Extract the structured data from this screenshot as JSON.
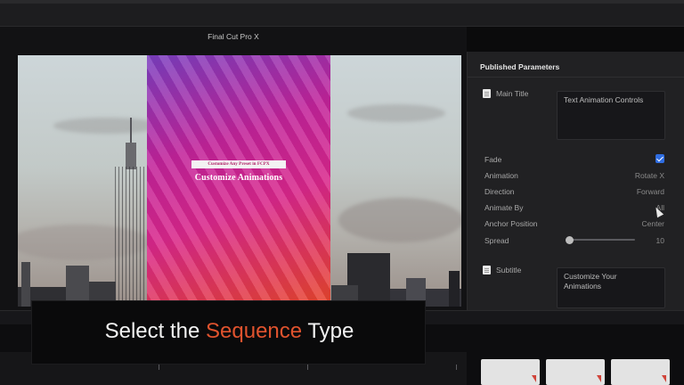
{
  "app": {
    "title": "Final Cut Pro X"
  },
  "promo": {
    "banner": "Customize Any Preset in FCPX",
    "heading": "Customize Animations"
  },
  "inspector": {
    "header": "Published Parameters",
    "main_title": {
      "label": "Main Title",
      "value": "Text Animation Controls"
    },
    "fade": {
      "label": "Fade",
      "checked": true
    },
    "animation": {
      "label": "Animation",
      "value": "Rotate X"
    },
    "direction": {
      "label": "Direction",
      "value": "Forward"
    },
    "animate_by": {
      "label": "Animate By",
      "value": "All"
    },
    "anchor_position": {
      "label": "Anchor Position",
      "value": "Center"
    },
    "spread": {
      "label": "Spread",
      "value": "10"
    },
    "subtitle": {
      "label": "Subtitle",
      "line1": "Customize Your",
      "line2": "Animations"
    }
  },
  "caption": {
    "before": "Select the ",
    "accent": "Sequence",
    "after": " Type"
  },
  "colors": {
    "accent": "#e0532e",
    "checkbox": "#2f6de1"
  },
  "icons": [
    "checkbox-icon",
    "cursor-icon"
  ]
}
